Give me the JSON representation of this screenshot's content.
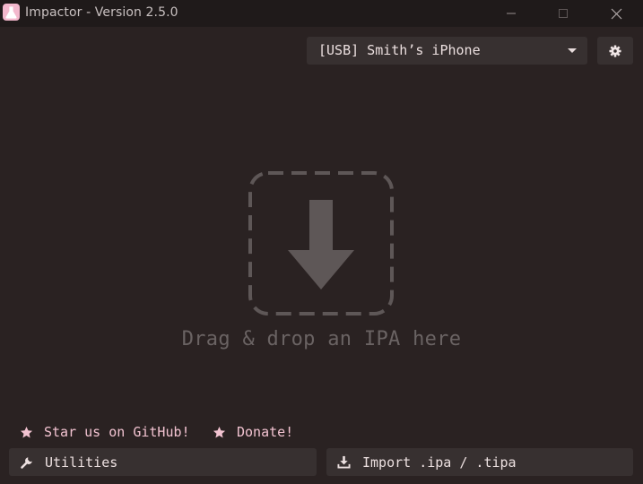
{
  "window": {
    "title": "Impactor - Version 2.5.0",
    "icon": "flask-icon",
    "controls": [
      "minimize-icon",
      "maximize-icon",
      "close-icon"
    ]
  },
  "toolbar": {
    "device_select": {
      "selected": "[USB] Smith’s iPhone",
      "icon": "chevron-down-icon"
    },
    "settings_icon": "gear-icon"
  },
  "drop_zone": {
    "icon": "download-arrow-icon",
    "text": "Drag & drop an IPA here"
  },
  "links": {
    "github": {
      "label": "Star us on GitHub!",
      "icon": "star-icon"
    },
    "donate": {
      "label": "Donate!",
      "icon": "star-icon"
    }
  },
  "buttons": {
    "utilities": {
      "label": "Utilities",
      "icon": "wrench-icon"
    },
    "import": {
      "label": "Import .ipa / .tipa",
      "icon": "download-icon"
    }
  },
  "colors": {
    "background": "#2a2222",
    "titlebar": "#1f1a1a",
    "control": "#373030",
    "accent_pink": "#f2c3d1",
    "muted_text": "#6a6363"
  }
}
